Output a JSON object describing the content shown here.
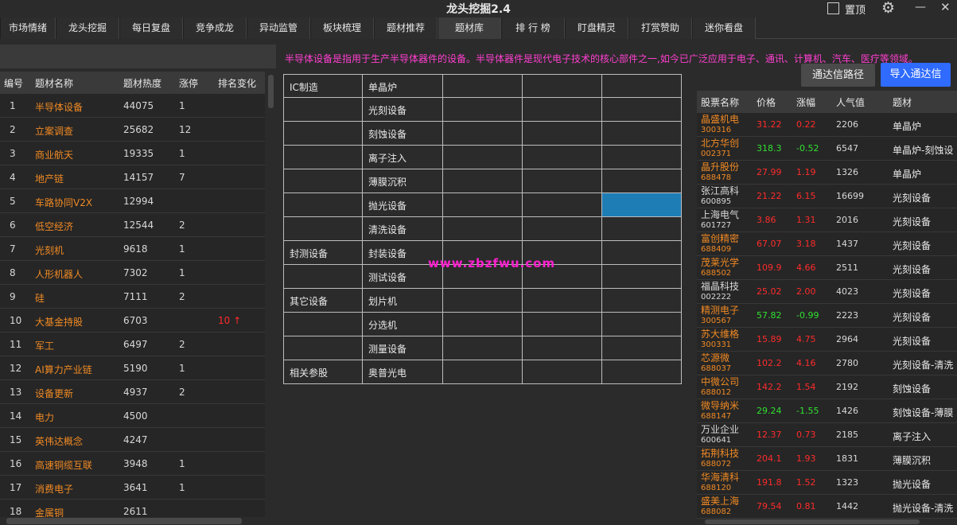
{
  "app": {
    "title": "龙头挖掘2.4",
    "pin_label": "置顶",
    "icons": {
      "settings": "gear-icon",
      "minimize": "minimize-icon",
      "close": "close-icon"
    }
  },
  "tabs": [
    {
      "label": "市场情绪",
      "active": false
    },
    {
      "label": "龙头挖掘",
      "active": false
    },
    {
      "label": "每日复盘",
      "active": false
    },
    {
      "label": "竞争成龙",
      "active": false
    },
    {
      "label": "异动监管",
      "active": false
    },
    {
      "label": "板块梳理",
      "active": false
    },
    {
      "label": "题材推荐",
      "active": false
    },
    {
      "label": "题材库",
      "active": true
    },
    {
      "label": "排 行 榜",
      "active": false
    },
    {
      "label": "盯盘精灵",
      "active": false
    },
    {
      "label": "打赏赞助",
      "active": false
    },
    {
      "label": "迷你看盘",
      "active": false
    }
  ],
  "description": "半导体设备是指用于生产半导体器件的设备。半导体器件是现代电子技术的核心部件之一,如今已广泛应用于电子、通讯、计算机、汽车、医疗等领域。",
  "watermark": "www.zbzfwu.com",
  "left_table": {
    "headers": [
      "编号",
      "题材名称",
      "题材热度",
      "涨停",
      "排名变化"
    ],
    "rows": [
      {
        "idx": "1",
        "name": "半导体设备",
        "heat": "44075",
        "limit": "1",
        "rank": ""
      },
      {
        "idx": "2",
        "name": "立案调查",
        "heat": "25682",
        "limit": "12",
        "rank": ""
      },
      {
        "idx": "3",
        "name": "商业航天",
        "heat": "19335",
        "limit": "1",
        "rank": ""
      },
      {
        "idx": "4",
        "name": "地产链",
        "heat": "14157",
        "limit": "7",
        "rank": ""
      },
      {
        "idx": "5",
        "name": "车路协同V2X",
        "heat": "12994",
        "limit": "",
        "rank": ""
      },
      {
        "idx": "6",
        "name": "低空经济",
        "heat": "12544",
        "limit": "2",
        "rank": ""
      },
      {
        "idx": "7",
        "name": "光刻机",
        "heat": "9618",
        "limit": "1",
        "rank": ""
      },
      {
        "idx": "8",
        "name": "人形机器人",
        "heat": "7302",
        "limit": "1",
        "rank": ""
      },
      {
        "idx": "9",
        "name": "硅",
        "heat": "7111",
        "limit": "2",
        "rank": ""
      },
      {
        "idx": "10",
        "name": "大基金持股",
        "heat": "6703",
        "limit": "",
        "rank": "10 ↑"
      },
      {
        "idx": "11",
        "name": "军工",
        "heat": "6497",
        "limit": "2",
        "rank": ""
      },
      {
        "idx": "12",
        "name": "AI算力产业链",
        "heat": "5190",
        "limit": "1",
        "rank": ""
      },
      {
        "idx": "13",
        "name": "设备更新",
        "heat": "4937",
        "limit": "2",
        "rank": ""
      },
      {
        "idx": "14",
        "name": "电力",
        "heat": "4500",
        "limit": "",
        "rank": ""
      },
      {
        "idx": "15",
        "name": "英伟达概念",
        "heat": "4247",
        "limit": "",
        "rank": ""
      },
      {
        "idx": "16",
        "name": "高速铜缆互联",
        "heat": "3948",
        "limit": "1",
        "rank": ""
      },
      {
        "idx": "17",
        "name": "消费电子",
        "heat": "3641",
        "limit": "1",
        "rank": ""
      },
      {
        "idx": "18",
        "name": "金属铜",
        "heat": "2611",
        "limit": "",
        "rank": ""
      }
    ]
  },
  "middle_grid": {
    "rows": [
      {
        "category": "IC制造",
        "item": "单晶炉",
        "highlight": false
      },
      {
        "category": "",
        "item": "光刻设备",
        "highlight": false
      },
      {
        "category": "",
        "item": "刻蚀设备",
        "highlight": false
      },
      {
        "category": "",
        "item": "离子注入",
        "highlight": false
      },
      {
        "category": "",
        "item": "薄膜沉积",
        "highlight": false
      },
      {
        "category": "",
        "item": "抛光设备",
        "highlight": true
      },
      {
        "category": "",
        "item": "清洗设备",
        "highlight": false
      },
      {
        "category": "封测设备",
        "item": "封装设备",
        "highlight": false
      },
      {
        "category": "",
        "item": "测试设备",
        "highlight": false
      },
      {
        "category": "其它设备",
        "item": "划片机",
        "highlight": false
      },
      {
        "category": "",
        "item": "分选机",
        "highlight": false
      },
      {
        "category": "",
        "item": "测量设备",
        "highlight": false
      },
      {
        "category": "相关参股",
        "item": "奥普光电",
        "highlight": false
      }
    ]
  },
  "buttons": {
    "path": "通达信路径",
    "import": "导入通达信"
  },
  "right_table": {
    "headers": [
      "股票名称",
      "价格",
      "涨幅",
      "人气值",
      "题材"
    ],
    "rows": [
      {
        "name": "晶盛机电",
        "code": "300316",
        "price": "31.22",
        "change": "0.22",
        "pop": "2206",
        "topic": "单晶炉",
        "dir": "up"
      },
      {
        "name": "北方华创",
        "code": "002371",
        "price": "318.3",
        "change": "-0.52",
        "pop": "6547",
        "topic": "单晶炉-刻蚀设",
        "dir": "down"
      },
      {
        "name": "晶升股份",
        "code": "688478",
        "price": "27.99",
        "change": "1.19",
        "pop": "1326",
        "topic": "单晶炉",
        "dir": "up"
      },
      {
        "name": "张江高科",
        "code": "600895",
        "price": "21.22",
        "change": "6.15",
        "pop": "16699",
        "topic": "光刻设备",
        "dir": "up",
        "name_plain": true
      },
      {
        "name": "上海电气",
        "code": "601727",
        "price": "3.86",
        "change": "1.31",
        "pop": "2016",
        "topic": "光刻设备",
        "dir": "up",
        "name_plain": true
      },
      {
        "name": "富创精密",
        "code": "688409",
        "price": "67.07",
        "change": "3.18",
        "pop": "1437",
        "topic": "光刻设备",
        "dir": "up"
      },
      {
        "name": "茂莱光学",
        "code": "688502",
        "price": "109.9",
        "change": "4.66",
        "pop": "2511",
        "topic": "光刻设备",
        "dir": "up"
      },
      {
        "name": "福晶科技",
        "code": "002222",
        "price": "25.02",
        "change": "2.00",
        "pop": "4023",
        "topic": "光刻设备",
        "dir": "up",
        "name_plain": true
      },
      {
        "name": "精测电子",
        "code": "300567",
        "price": "57.82",
        "change": "-0.99",
        "pop": "2223",
        "topic": "光刻设备",
        "dir": "down",
        "name_plain": false
      },
      {
        "name": "苏大维格",
        "code": "300331",
        "price": "15.89",
        "change": "4.75",
        "pop": "2964",
        "topic": "光刻设备",
        "dir": "up"
      },
      {
        "name": "芯源微",
        "code": "688037",
        "price": "102.2",
        "change": "4.16",
        "pop": "2780",
        "topic": "光刻设备-清洗",
        "dir": "up"
      },
      {
        "name": "中微公司",
        "code": "688012",
        "price": "142.2",
        "change": "1.54",
        "pop": "2192",
        "topic": "刻蚀设备",
        "dir": "up"
      },
      {
        "name": "微导纳米",
        "code": "688147",
        "price": "29.24",
        "change": "-1.55",
        "pop": "1426",
        "topic": "刻蚀设备-薄膜",
        "dir": "down",
        "name_plain": false
      },
      {
        "name": "万业企业",
        "code": "600641",
        "price": "12.37",
        "change": "0.73",
        "pop": "2185",
        "topic": "离子注入",
        "dir": "up",
        "name_plain": true
      },
      {
        "name": "拓荆科技",
        "code": "688072",
        "price": "204.1",
        "change": "1.93",
        "pop": "1831",
        "topic": "薄膜沉积",
        "dir": "up"
      },
      {
        "name": "华海清科",
        "code": "688120",
        "price": "191.8",
        "change": "1.52",
        "pop": "1323",
        "topic": "抛光设备",
        "dir": "up"
      },
      {
        "name": "盛美上海",
        "code": "688082",
        "price": "79.54",
        "change": "0.81",
        "pop": "1442",
        "topic": "抛光设备-清洗",
        "dir": "up"
      }
    ]
  }
}
